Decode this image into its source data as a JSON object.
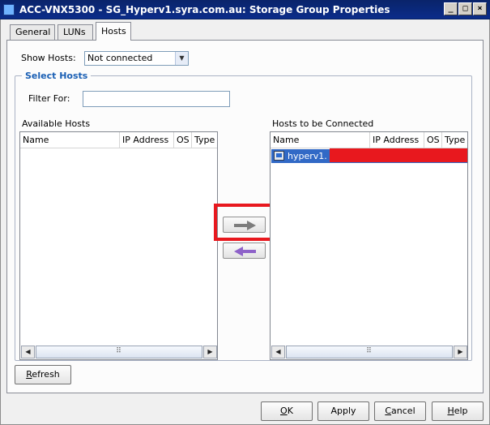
{
  "window": {
    "title": "ACC-VNX5300 - SG_Hyperv1.syra.com.au: Storage Group Properties",
    "minimize_glyph": "_",
    "maximize_glyph": "□",
    "close_glyph": "×"
  },
  "tabs": [
    {
      "label": "General",
      "active": false
    },
    {
      "label": "LUNs",
      "active": false
    },
    {
      "label": "Hosts",
      "active": true
    }
  ],
  "show_hosts": {
    "label": "Show Hosts:",
    "selected": "Not connected"
  },
  "select_hosts": {
    "title": "Select Hosts",
    "filter_label": "Filter For:",
    "filter_value": ""
  },
  "available_hosts": {
    "title": "Available Hosts",
    "columns": [
      "Name",
      "IP Address",
      "OS",
      "Type"
    ],
    "rows": []
  },
  "hosts_to_connect": {
    "title": "Hosts to be Connected",
    "columns": [
      "Name",
      "IP Address",
      "OS",
      "Type"
    ],
    "rows": [
      {
        "name": "hyperv1.",
        "selected": true
      }
    ]
  },
  "scrollbar": {
    "thumb_grip": "⠿",
    "left_glyph": "◀",
    "right_glyph": "▶"
  },
  "buttons": {
    "refresh": {
      "mnemonic": "R",
      "rest": "efresh"
    },
    "ok": {
      "mnemonic": "O",
      "rest": "K"
    },
    "apply": {
      "label": "Apply"
    },
    "cancel": {
      "mnemonic": "C",
      "rest": "ancel"
    },
    "help": {
      "mnemonic": "H",
      "rest": "elp"
    }
  },
  "colors": {
    "titlebar": "#0a246a",
    "accent_blue": "#1a5fb4",
    "selection": "#3169c6",
    "annotation_red": "#e8181e",
    "add_arrow": "#7c7c7c",
    "remove_arrow": "#8e62c9"
  }
}
